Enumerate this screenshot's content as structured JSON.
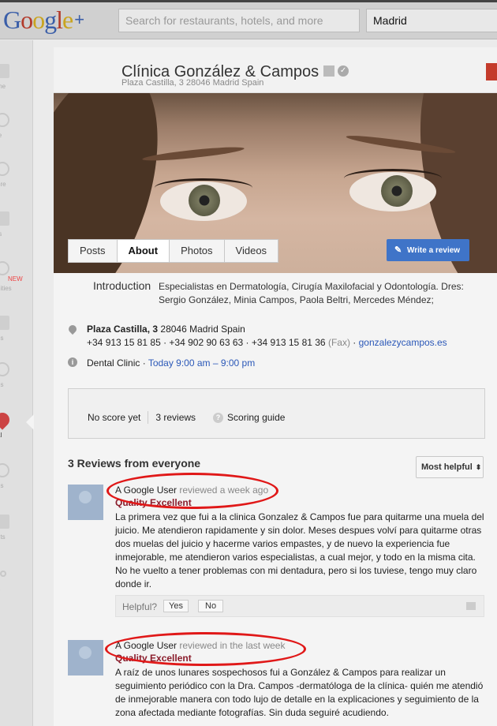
{
  "topbar": {
    "logo_google": "Google",
    "logo_plus": "+",
    "search_placeholder": "Search for restaurants, hotels, and more",
    "location_value": "Madrid"
  },
  "leftnav": {
    "items": [
      {
        "label": "me",
        "icon": "home-icon"
      },
      {
        "label": "le",
        "icon": "profile-icon"
      },
      {
        "label": "ore",
        "icon": "explore-icon"
      },
      {
        "label": "ts",
        "icon": "events-icon"
      },
      {
        "label": "nities",
        "icon": "communities-icon",
        "badge": "NEW"
      },
      {
        "label": "os",
        "icon": "photos-icon"
      },
      {
        "label": "es",
        "icon": "pages-icon"
      },
      {
        "label": "al",
        "icon": "local-icon",
        "active": true
      },
      {
        "label": "es",
        "icon": "games-icon"
      },
      {
        "label": "uts",
        "icon": "hangouts-icon"
      },
      {
        "label": "e",
        "icon": "more-icon"
      }
    ]
  },
  "place": {
    "name": "Clínica González & Campos",
    "address_short": "Plaza Castilla, 3 28046 Madrid Spain"
  },
  "tabs": [
    "Posts",
    "About",
    "Photos",
    "Videos"
  ],
  "active_tab": "About",
  "write_review_label": "Write a review",
  "about": {
    "intro_label": "Introduction",
    "intro_text": "Especialistas en Dermatología, Cirugía Maxilofacial y Odontología. Dres: Sergio González, Minia Campos, Paola Beltri, Mercedes Méndez;",
    "street": "Plaza Castilla, 3",
    "city": "28046 Madrid Spain",
    "phones": "+34 913 15 81 85 · +34 902 90 63 63 · +34 913 15 81 36",
    "fax_label": "(Fax)",
    "website": "gonzalezycampos.es",
    "category": "Dental Clinic",
    "hours": "Today 9:00 am – 9:00 pm"
  },
  "score": {
    "no_score": "No score yet",
    "reviews_count": "3 reviews",
    "guide": "Scoring guide"
  },
  "reviews_section": {
    "title": "3 Reviews from everyone",
    "sort_label": "Most helpful"
  },
  "reviews": [
    {
      "author": "A Google User",
      "when": "reviewed a week ago",
      "rating": "Quality Excellent",
      "text": "La primera vez que fui a la clinica Gonzalez & Campos fue para quitarme una muela del juicio. Me atendieron rapidamente y sin dolor. Meses despues volví para quitarme otras dos muelas del juicio y hacerme varios empastes, y de nuevo la experiencia fue inmejorable, me atendieron varios especialistas, a cual mejor, y todo en la misma cita. No he vuelto a tener problemas con mi dentadura, pero si los tuviese, tengo muy claro donde ir.",
      "helpful_label": "Helpful?",
      "yes_label": "Yes",
      "no_label": "No"
    },
    {
      "author": "A Google User",
      "when": "reviewed in the last week",
      "rating": "Quality Excellent",
      "text": "A raíz de unos lunares sospechosos fui a González & Campos para realizar un seguimiento periódico con la Dra. Campos -dermatóloga de la clínica- quién me atendió de inmejorable manera con todo lujo de detalle en la explicaciones y seguimiento de la zona afectada mediante fotografías. Sin duda seguiré acudiendo."
    }
  ],
  "colors": {
    "accent_blue": "#3f74c8",
    "highlight_oval": "#e01818",
    "rating_red": "#8a1c2b"
  }
}
